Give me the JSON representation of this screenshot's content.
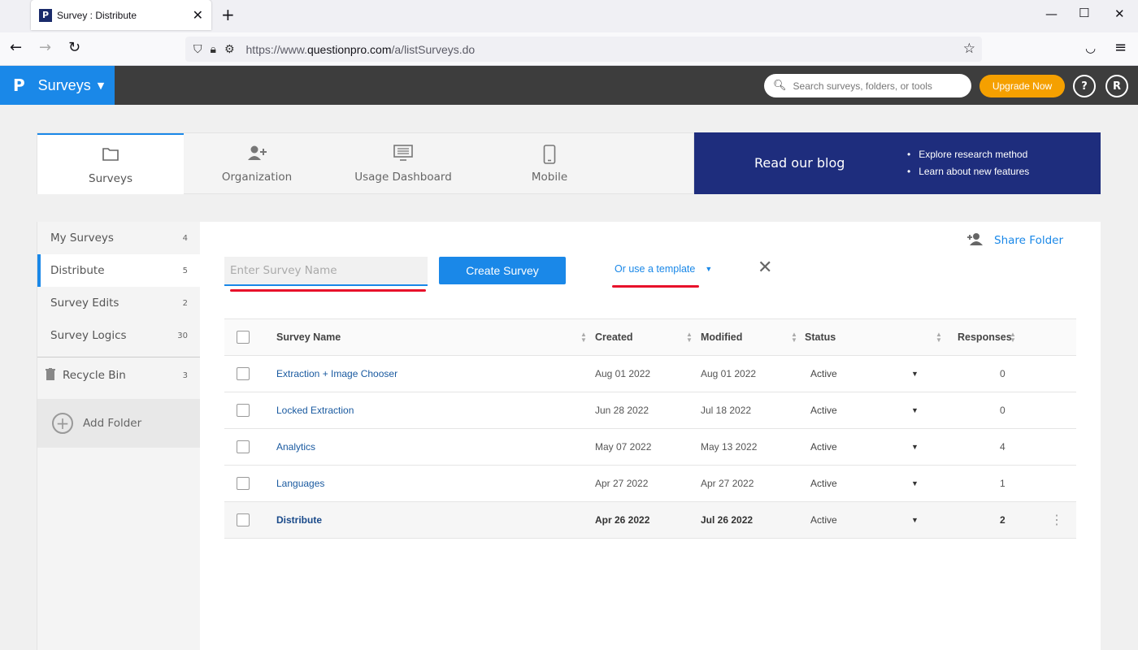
{
  "browser": {
    "tab_title": "Survey : Distribute",
    "url_prefix": "https://www.",
    "url_domain": "questionpro.com",
    "url_path": "/a/listSurveys.do"
  },
  "header": {
    "brand_logo": "P",
    "brand": "Surveys",
    "search_placeholder": "Search surveys, folders, or tools",
    "upgrade_label": "Upgrade Now",
    "help_label": "?",
    "avatar_label": "R"
  },
  "topnav": {
    "items": [
      {
        "label": "Surveys",
        "icon": "folder-icon"
      },
      {
        "label": "Organization",
        "icon": "add-user-icon"
      },
      {
        "label": "Usage Dashboard",
        "icon": "monitor-icon"
      },
      {
        "label": "Mobile",
        "icon": "mobile-icon"
      }
    ],
    "blog": {
      "title": "Read our blog",
      "bullets": [
        "Explore research method",
        "Learn about new features"
      ]
    }
  },
  "sidebar": {
    "items": [
      {
        "label": "My Surveys",
        "count": "4"
      },
      {
        "label": "Distribute",
        "count": "5"
      },
      {
        "label": "Survey Edits",
        "count": "2"
      },
      {
        "label": "Survey Logics",
        "count": "30"
      }
    ],
    "recycle": {
      "label": "Recycle Bin",
      "count": "3"
    },
    "add_folder": "Add Folder"
  },
  "main": {
    "share_label": "Share Folder",
    "name_placeholder": "Enter Survey Name",
    "create_label": "Create Survey",
    "template_label": "Or use a template"
  },
  "table": {
    "headers": {
      "name": "Survey Name",
      "created": "Created",
      "modified": "Modified",
      "status": "Status",
      "responses": "Responses"
    },
    "rows": [
      {
        "name": "Extraction + Image Chooser",
        "created": "Aug 01 2022",
        "modified": "Aug 01 2022",
        "status": "Active",
        "responses": "0"
      },
      {
        "name": "Locked Extraction",
        "created": "Jun 28 2022",
        "modified": "Jul 18 2022",
        "status": "Active",
        "responses": "0"
      },
      {
        "name": "Analytics",
        "created": "May 07 2022",
        "modified": "May 13 2022",
        "status": "Active",
        "responses": "4"
      },
      {
        "name": "Languages",
        "created": "Apr 27 2022",
        "modified": "Apr 27 2022",
        "status": "Active",
        "responses": "1"
      },
      {
        "name": "Distribute",
        "created": "Apr 26 2022",
        "modified": "Jul 26 2022",
        "status": "Active",
        "responses": "2"
      }
    ]
  },
  "colors": {
    "accent": "#1a88e8",
    "blog_bg": "#1e2d7d",
    "upgrade": "#f5a000",
    "annotation": "#e8102a"
  }
}
